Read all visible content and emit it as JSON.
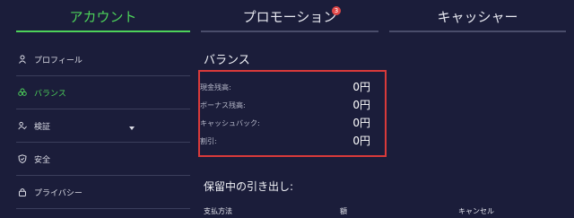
{
  "tabs": [
    {
      "label": "アカウント",
      "active": true
    },
    {
      "label": "プロモーション",
      "badge": "3"
    },
    {
      "label": "キャッシャー"
    }
  ],
  "sidebar": {
    "items": [
      {
        "label": "プロフィール",
        "icon": "user-icon"
      },
      {
        "label": "バランス",
        "icon": "coins-icon",
        "active": true
      },
      {
        "label": "検証",
        "icon": "user-check-icon"
      },
      {
        "label": "安全",
        "icon": "shield-icon"
      },
      {
        "label": "プライバシー",
        "icon": "lock-icon"
      }
    ]
  },
  "balance": {
    "title": "バランス",
    "rows": [
      {
        "label": "現金残高:",
        "value": "0円"
      },
      {
        "label": "ボーナス残高:",
        "value": "0円"
      },
      {
        "label": "キャッシュバック:",
        "value": "0円"
      },
      {
        "label": "割引:",
        "value": "0円"
      }
    ]
  },
  "pending": {
    "title": "保留中の引き出し:",
    "columns": [
      "支払方法",
      "額",
      "キャンセル"
    ]
  },
  "colors": {
    "background": "#1b1d3a",
    "accent": "#4dd25a",
    "highlight_box": "#d93a3a"
  }
}
